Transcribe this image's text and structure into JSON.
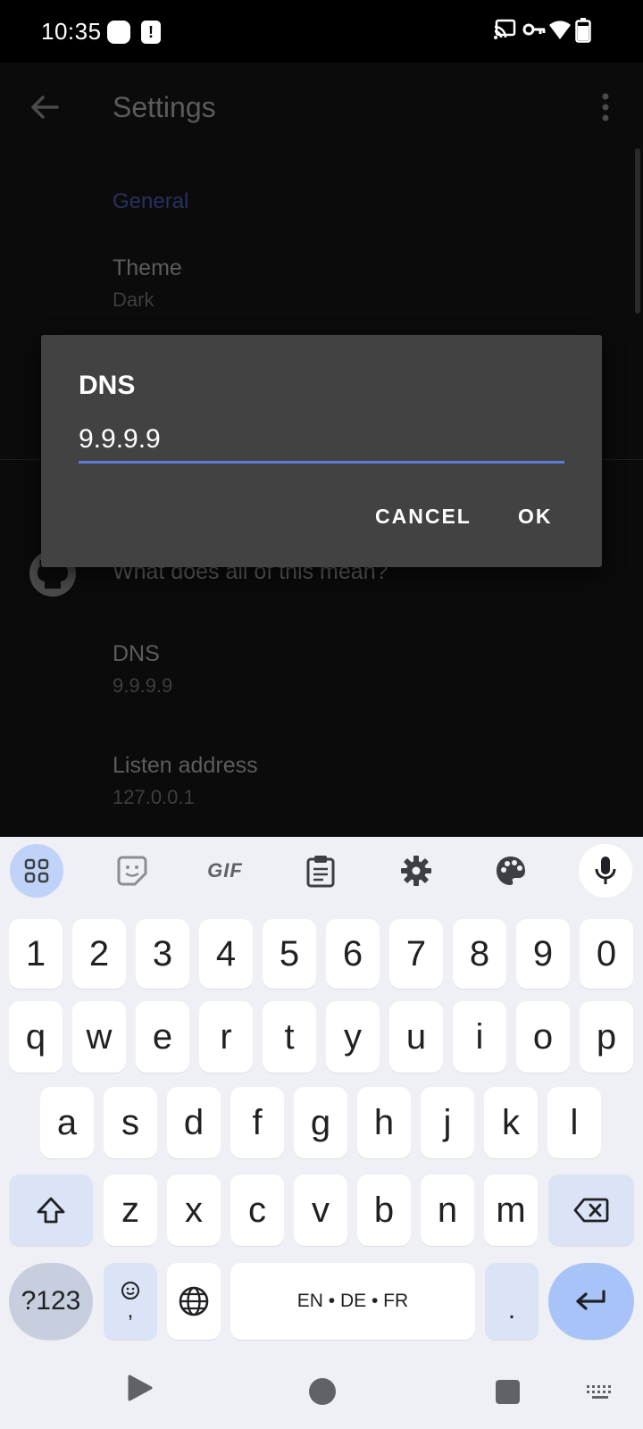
{
  "status_bar": {
    "time": "10:35"
  },
  "app_bar": {
    "title": "Settings"
  },
  "settings": {
    "section_general": "General",
    "theme": {
      "title": "Theme",
      "summary": "Dark"
    },
    "help": {
      "title": "What does all of this mean?"
    },
    "dns": {
      "title": "DNS",
      "summary": "9.9.9.9"
    },
    "listen": {
      "title": "Listen address",
      "summary": "127.0.0.1"
    }
  },
  "dialog": {
    "title": "DNS",
    "input_value": "9.9.9.9",
    "cancel_label": "CANCEL",
    "ok_label": "OK",
    "accent_color": "#5f7cd8"
  },
  "keyboard": {
    "gif_label": "GIF",
    "row_numbers": [
      "1",
      "2",
      "3",
      "4",
      "5",
      "6",
      "7",
      "8",
      "9",
      "0"
    ],
    "row_1": [
      "q",
      "w",
      "e",
      "r",
      "t",
      "y",
      "u",
      "i",
      "o",
      "p"
    ],
    "row_2": [
      "a",
      "s",
      "d",
      "f",
      "g",
      "h",
      "j",
      "k",
      "l"
    ],
    "row_3": [
      "z",
      "x",
      "c",
      "v",
      "b",
      "n",
      "m"
    ],
    "symbols_label": "?123",
    "comma": ",",
    "space_label": "EN • DE • FR",
    "period": "."
  }
}
